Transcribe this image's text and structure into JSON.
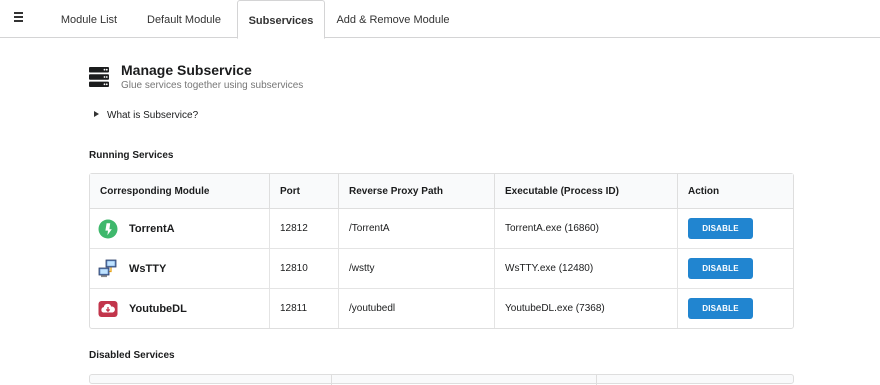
{
  "nav": {
    "menu_icon": "hamburger-icon",
    "tabs": [
      {
        "label": "Module List",
        "active": false
      },
      {
        "label": "Default Module",
        "active": false
      },
      {
        "label": "Subservices",
        "active": true
      },
      {
        "label": "Add & Remove Module",
        "active": false
      }
    ]
  },
  "header": {
    "icon": "server-icon",
    "title": "Manage Subservice",
    "subtitle": "Glue services together using subservices"
  },
  "accordion": {
    "label": "What is Subservice?"
  },
  "running": {
    "heading": "Running Services",
    "columns": [
      "Corresponding Module",
      "Port",
      "Reverse Proxy Path",
      "Executable (Process ID)",
      "Action"
    ],
    "rows": [
      {
        "module": "TorrentA",
        "icon": "torrent-icon",
        "port": "12812",
        "path": "/TorrentA",
        "exe": "TorrentA.exe (16860)",
        "action": "DISABLE"
      },
      {
        "module": "WsTTY",
        "icon": "network-computers-icon",
        "port": "12810",
        "path": "/wstty",
        "exe": "WsTTY.exe (12480)",
        "action": "DISABLE"
      },
      {
        "module": "YoutubeDL",
        "icon": "download-cloud-icon",
        "port": "12811",
        "path": "/youtubedl",
        "exe": "YoutubeDL.exe (7368)",
        "action": "DISABLE"
      }
    ]
  },
  "disabled": {
    "heading": "Disabled Services"
  },
  "colors": {
    "accent": "#2185d0",
    "torrent": "#3fb86c",
    "youtube": "#c2354b"
  }
}
